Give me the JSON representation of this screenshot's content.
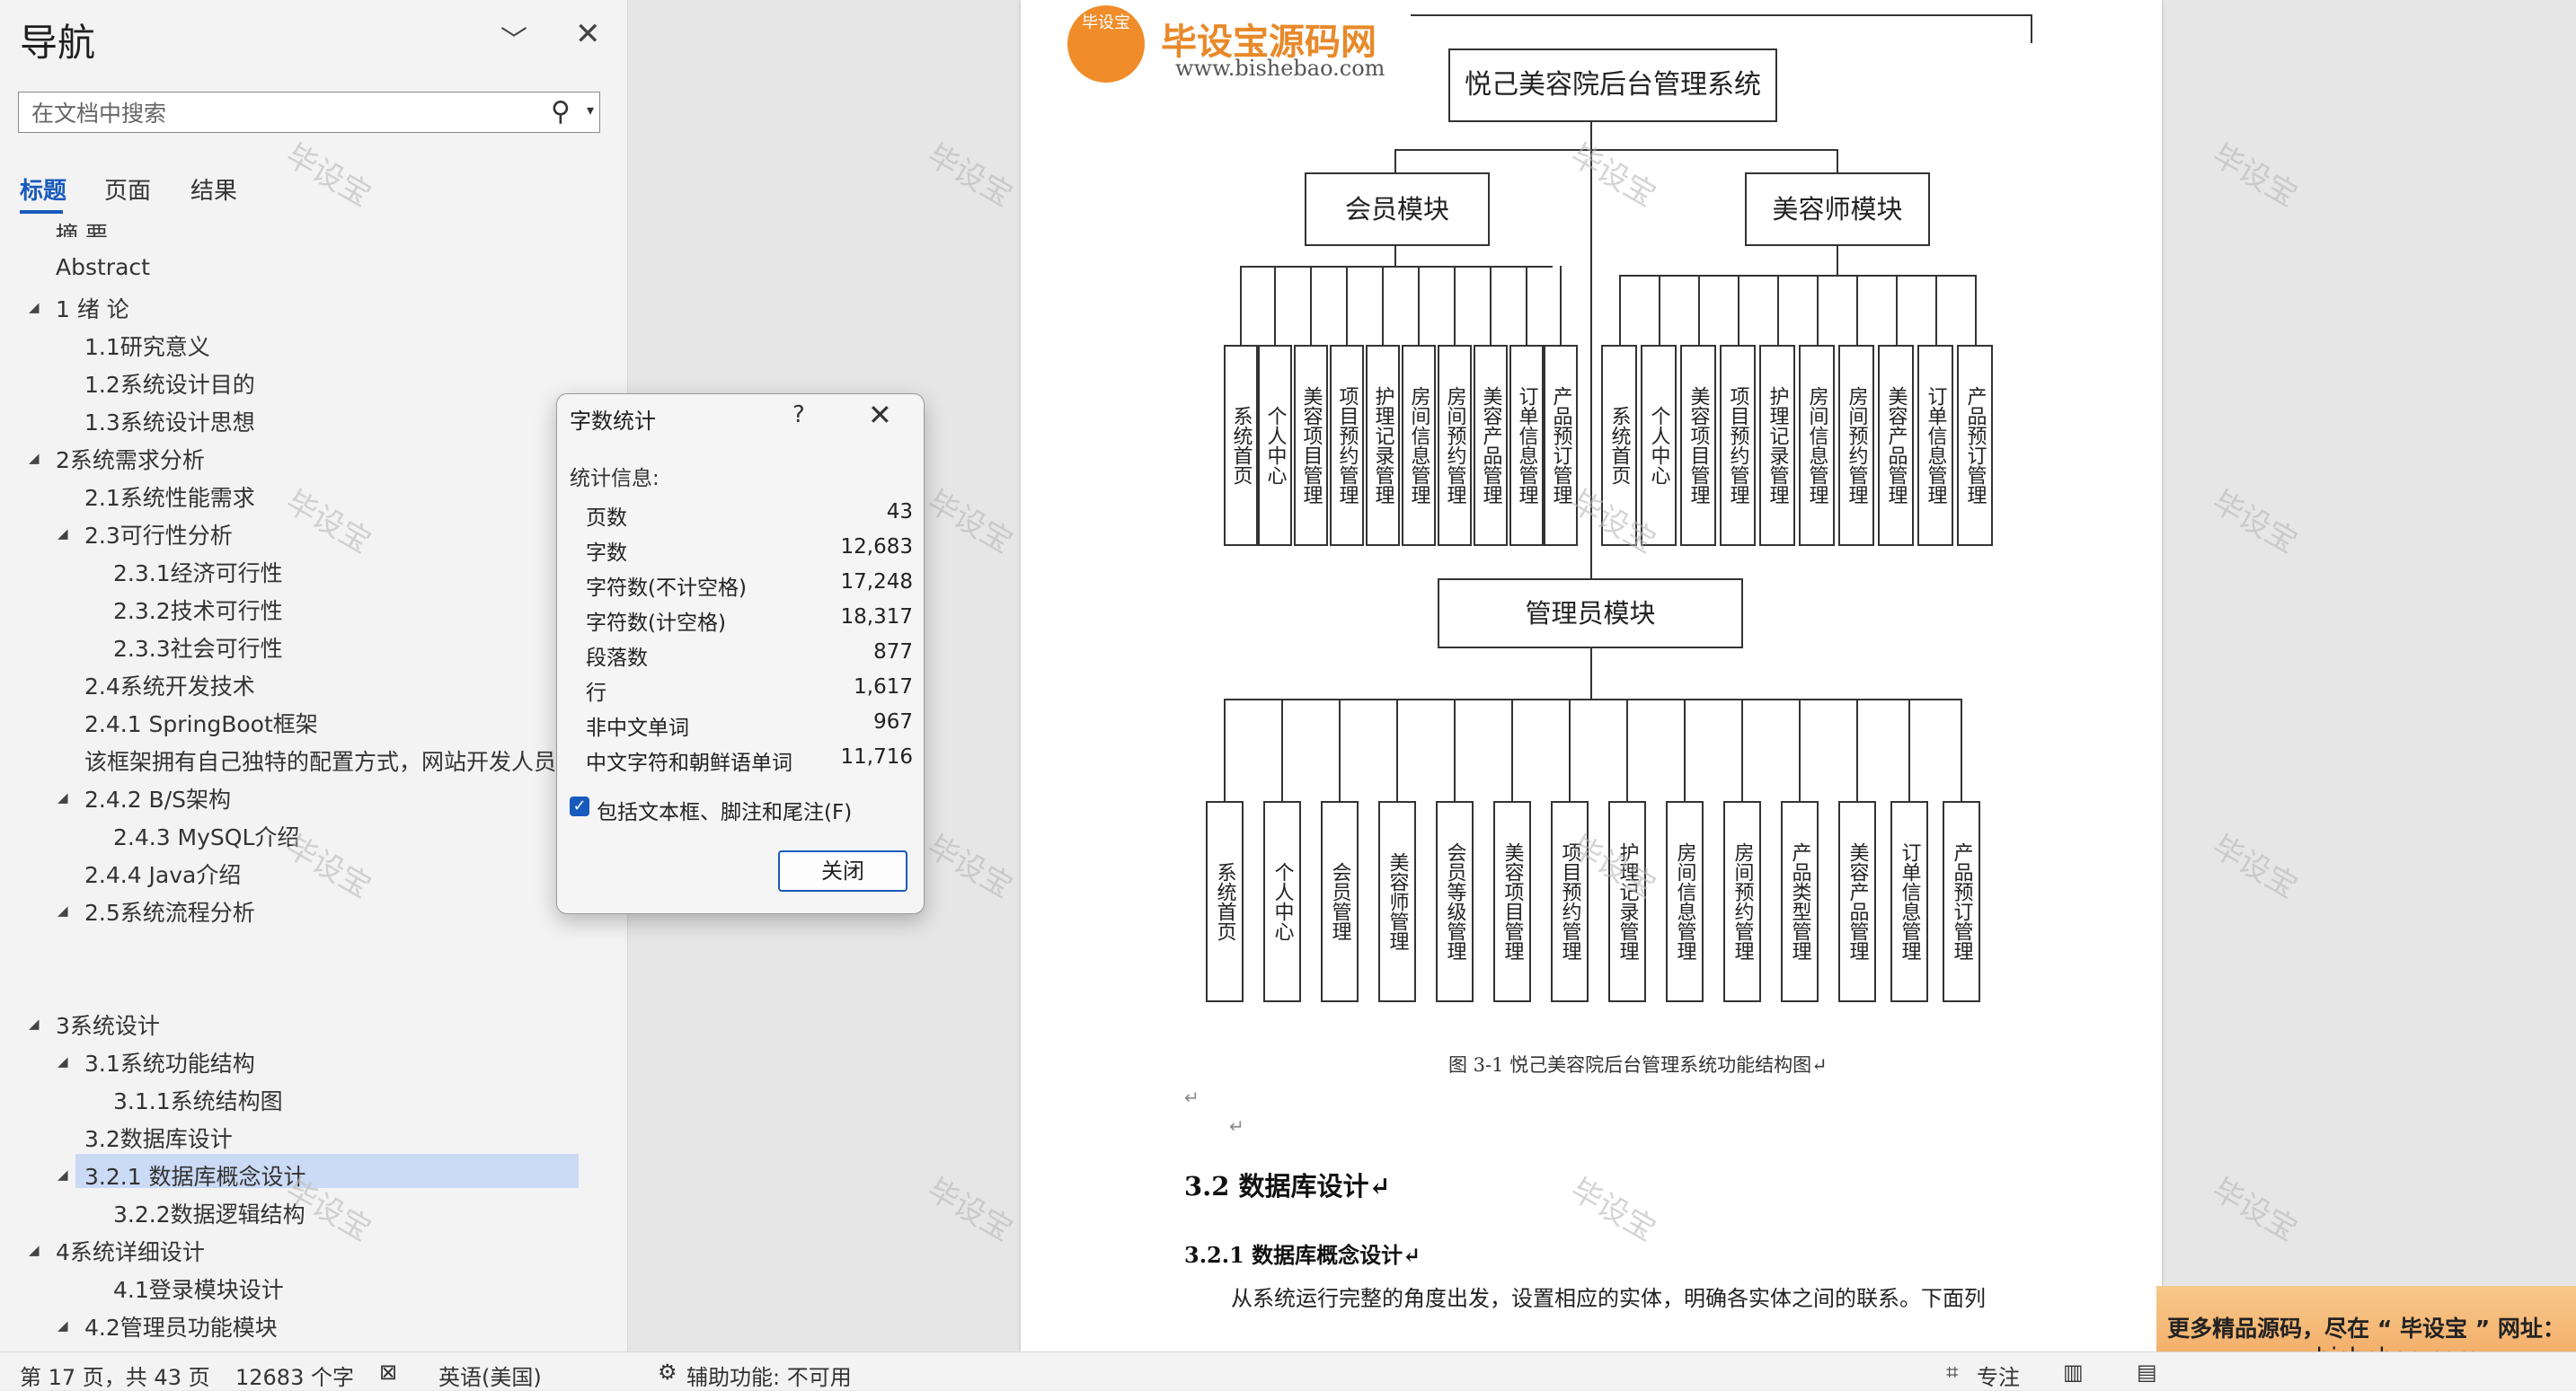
{
  "nav": {
    "title": "导航",
    "search_placeholder": "在文档中搜索",
    "tabs": [
      "标题",
      "页面",
      "结果"
    ],
    "tree": [
      {
        "label": "摘 要",
        "level": 1,
        "arrow": ""
      },
      {
        "label": "Abstract",
        "level": 1,
        "arrow": ""
      },
      {
        "label": "1 绪  论",
        "level": 1,
        "arrow": "◢"
      },
      {
        "label": "1.1研究意义",
        "level": 2,
        "arrow": ""
      },
      {
        "label": "1.2系统设计目的",
        "level": 2,
        "arrow": ""
      },
      {
        "label": "1.3系统设计思想",
        "level": 2,
        "arrow": ""
      },
      {
        "label": "2系统需求分析",
        "level": 1,
        "arrow": "◢"
      },
      {
        "label": "2.1系统性能需求",
        "level": 2,
        "arrow": ""
      },
      {
        "label": "2.3可行性分析",
        "level": 2,
        "arrow": "◢"
      },
      {
        "label": "2.3.1经济可行性",
        "level": 3,
        "arrow": ""
      },
      {
        "label": "2.3.2技术可行性",
        "level": 3,
        "arrow": ""
      },
      {
        "label": "2.3.3社会可行性",
        "level": 3,
        "arrow": ""
      },
      {
        "label": "2.4系统开发技术",
        "level": 2,
        "arrow": ""
      },
      {
        "label": "2.4.1 SpringBoot框架",
        "level": 2,
        "arrow": ""
      },
      {
        "label": "该框架拥有自己独特的配置方式，网站开发人员不",
        "level": 2,
        "arrow": ""
      },
      {
        "label": "2.4.2 B/S架构",
        "level": 2,
        "arrow": "◢"
      },
      {
        "label": "2.4.3 MySQL介绍",
        "level": 3,
        "arrow": ""
      },
      {
        "label": "2.4.4 Java介绍",
        "level": 2,
        "arrow": ""
      },
      {
        "label": "2.5系统流程分析",
        "level": 2,
        "arrow": "◢"
      },
      {
        "label": "3系统设计",
        "level": 1,
        "arrow": "◢"
      },
      {
        "label": "3.1系统功能结构",
        "level": 2,
        "arrow": "◢"
      },
      {
        "label": "3.1.1系统结构图",
        "level": 3,
        "arrow": ""
      },
      {
        "label": "3.2数据库设计",
        "level": 2,
        "arrow": ""
      },
      {
        "label": "3.2.1 数据库概念设计",
        "level": 2,
        "arrow": "◢"
      },
      {
        "label": "3.2.2数据逻辑结构",
        "level": 3,
        "arrow": ""
      },
      {
        "label": "4系统详细设计",
        "level": 1,
        "arrow": "◢"
      },
      {
        "label": "4.1登录模块设计",
        "level": 3,
        "arrow": ""
      },
      {
        "label": "4.2管理员功能模块",
        "level": 2,
        "arrow": "◢"
      }
    ]
  },
  "dialog": {
    "title": "字数统计",
    "help": "?",
    "section": "统计信息:",
    "stats": [
      {
        "label": "页数",
        "value": "43"
      },
      {
        "label": "字数",
        "value": "12,683"
      },
      {
        "label": "字符数(不计空格)",
        "value": "17,248"
      },
      {
        "label": "字符数(计空格)",
        "value": "18,317"
      },
      {
        "label": "段落数",
        "value": "877"
      },
      {
        "label": "行",
        "value": "1,617"
      },
      {
        "label": "非中文单词",
        "value": "967"
      },
      {
        "label": "中文字符和朝鲜语单词",
        "value": "11,716"
      }
    ],
    "checkbox_label": "包括文本框、脚注和尾注(F)",
    "close_button": "关闭"
  },
  "logo": {
    "badge": "毕设宝",
    "name": "毕设宝源码网",
    "url": "www.bishebao.com"
  },
  "watermark": "毕设宝",
  "diagram": {
    "root": "悦己美容院后台管理系统",
    "member_module": "会员模块",
    "beautician_module": "美容师模块",
    "admin_module": "管理员模块",
    "member_items": [
      "系统首页",
      "个人中心",
      "美容项目管理",
      "项目预约管理",
      "护理记录管理",
      "房间信息管理",
      "房间预约管理",
      "美容产品管理",
      "订单信息管理",
      "产品预订管理"
    ],
    "beautician_items": [
      "系统首页",
      "个人中心",
      "美容项目管理",
      "项目预约管理",
      "护理记录管理",
      "房间信息管理",
      "房间预约管理",
      "美容产品管理",
      "订单信息管理",
      "产品预订管理"
    ],
    "admin_items": [
      "系统首页",
      "个人中心",
      "会员管理",
      "美容师管理",
      "会员等级管理",
      "美容项目管理",
      "项目预约管理",
      "护理记录管理",
      "房间信息管理",
      "房间预约管理",
      "产品类型管理",
      "美容产品管理",
      "订单信息管理",
      "产品预订管理"
    ]
  },
  "doc": {
    "caption": "图 3-1  悦己美容院后台管理系统功能结构图↵",
    "heading1": "3.2 数据库设计↵",
    "heading2": "3.2.1  数据库概念设计↵",
    "body": "从系统运行完整的角度出发，设置相应的实体，明确各实体之间的联系。下面列",
    "mark": "↵"
  },
  "status": {
    "page": "第 17 页，共 43 页",
    "words": "12683 个字",
    "language": "英语(美国)",
    "accessibility": "辅助功能: 不可用",
    "focus": "专注"
  },
  "promo": {
    "line1": "更多精品源码，尽在 “ 毕设宝 ” 网址：",
    "line2": "www.bishebao.com"
  }
}
